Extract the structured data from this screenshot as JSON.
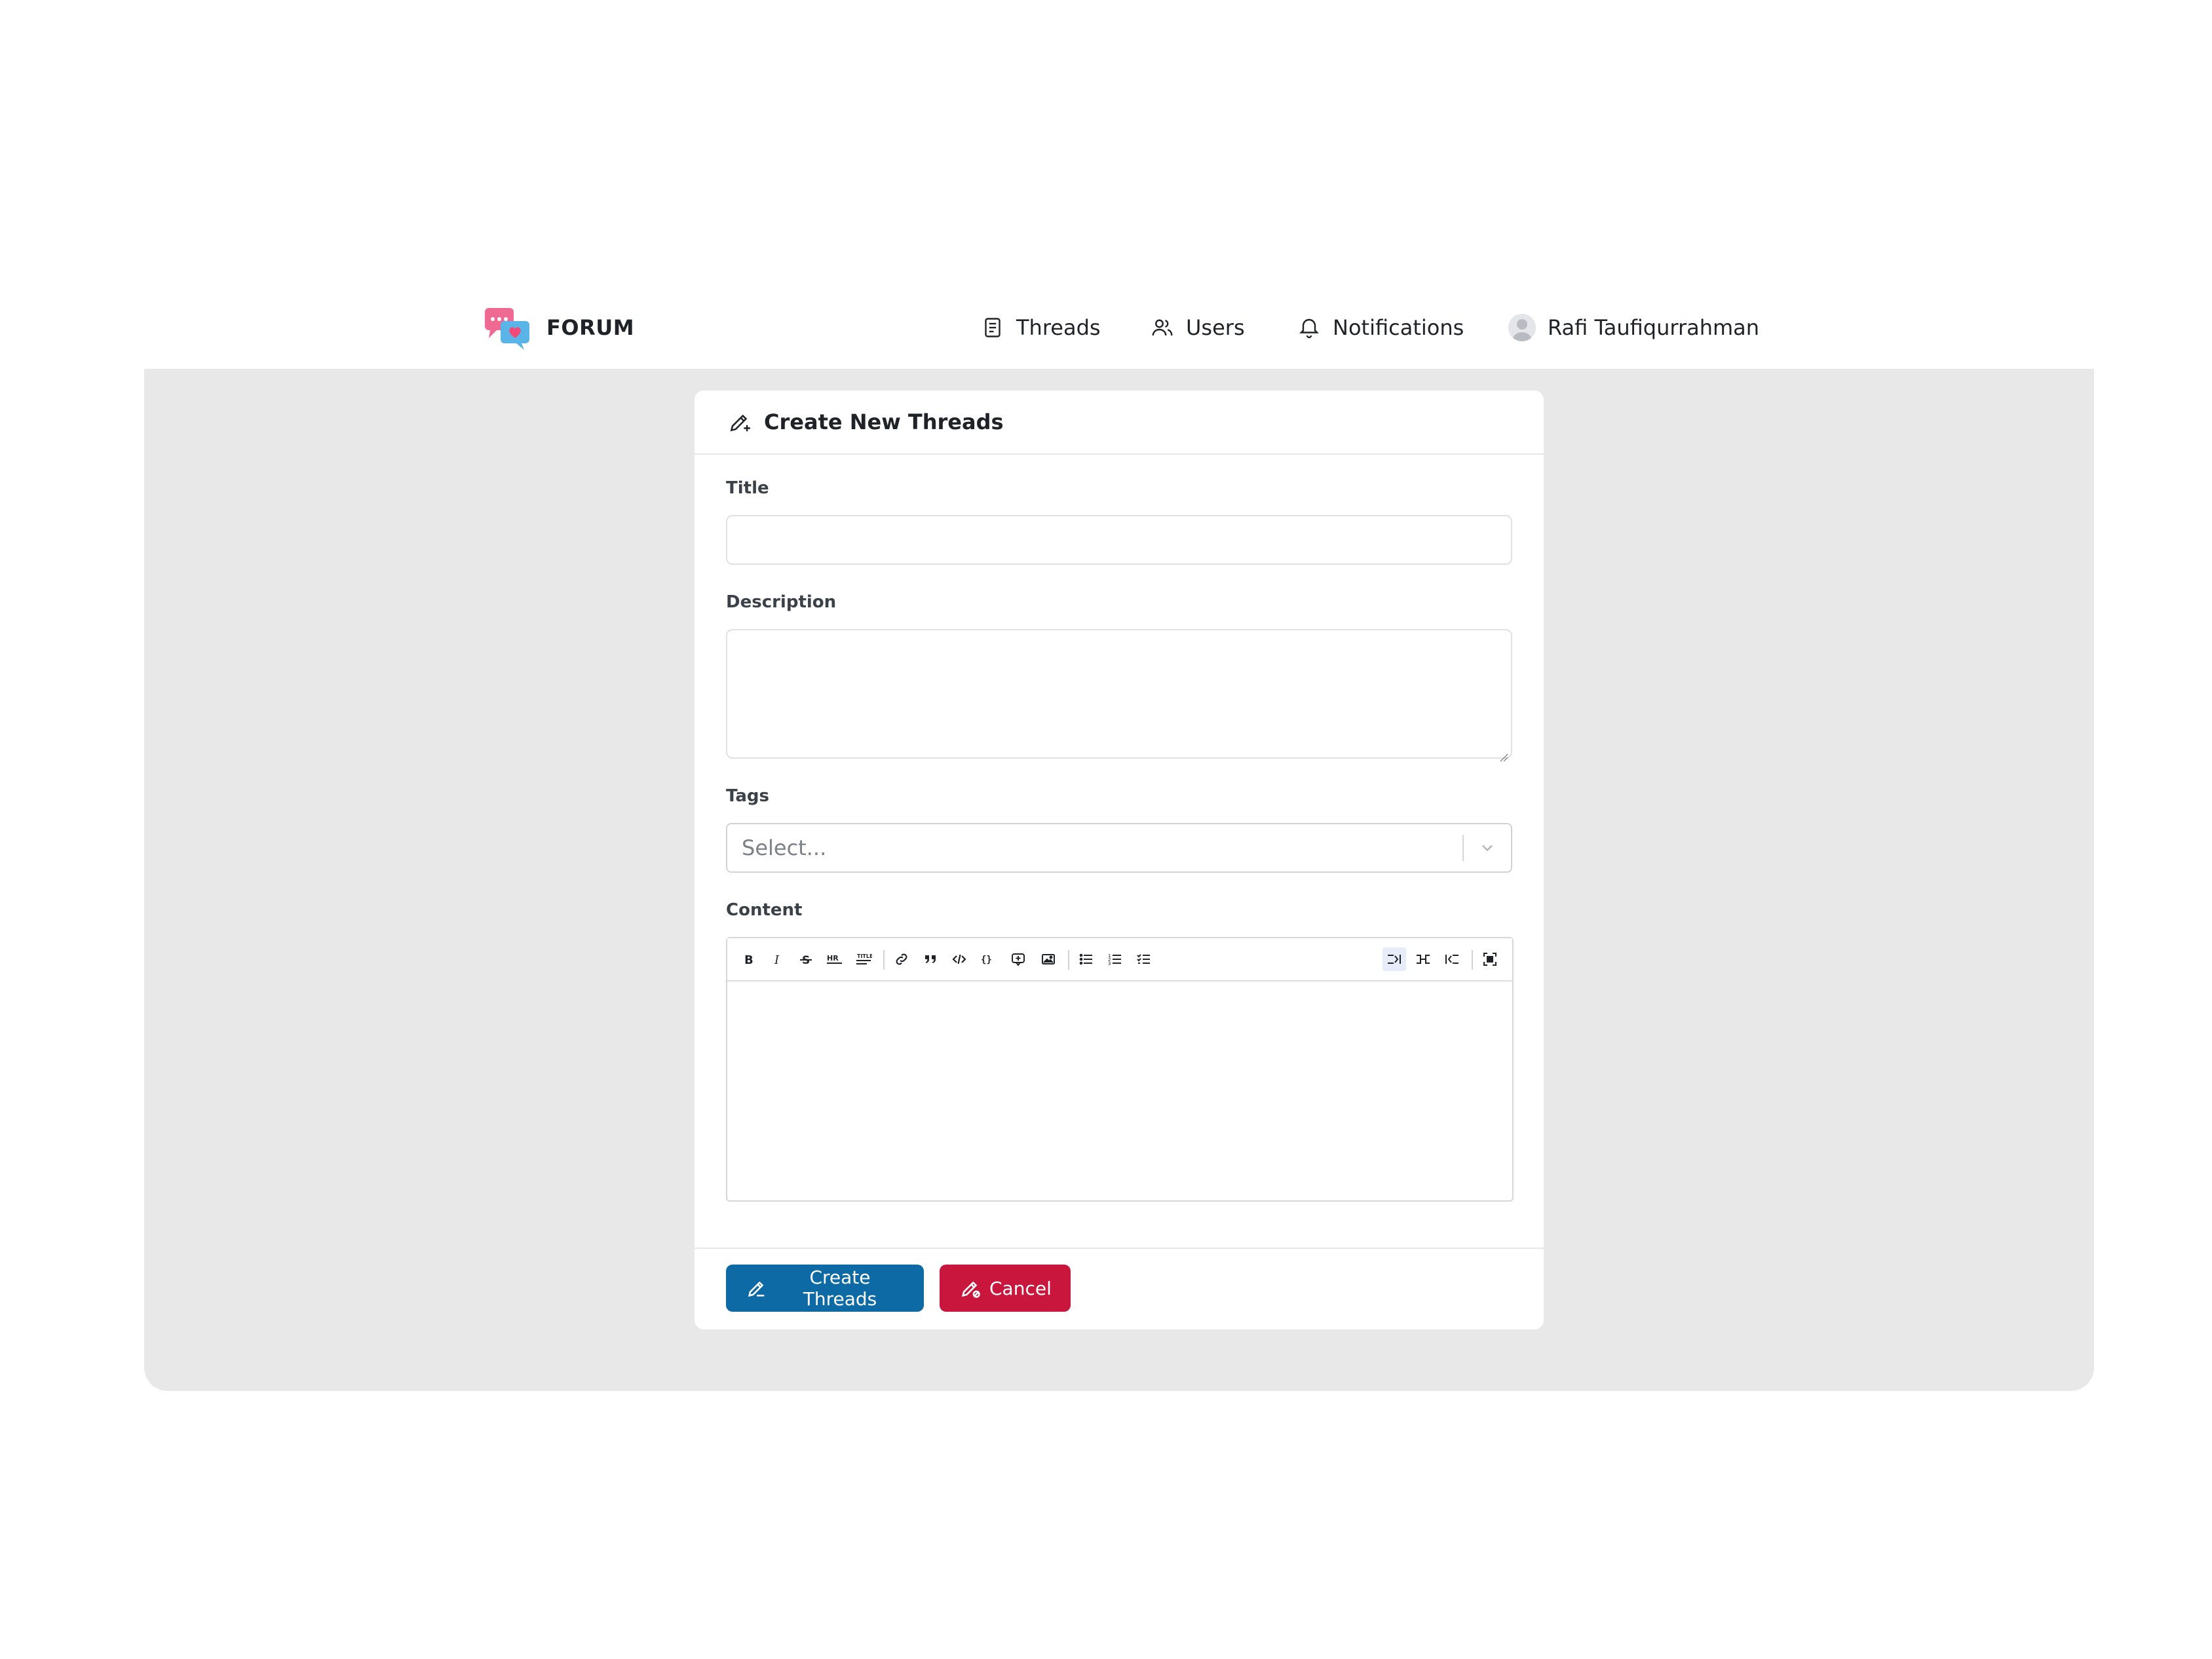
{
  "brand": {
    "name": "FORUM"
  },
  "nav": {
    "threads": "Threads",
    "users": "Users",
    "notifications": "Notifications",
    "profile": "Rafi Taufiqurrahman"
  },
  "card": {
    "title": "Create New Threads"
  },
  "form": {
    "title_label": "Title",
    "title_value": "",
    "description_label": "Description",
    "description_value": "",
    "tags_label": "Tags",
    "tags_placeholder": "Select...",
    "content_label": "Content"
  },
  "toolbar": {
    "tools": [
      "bold-icon",
      "italic-icon",
      "strikethrough-icon",
      "hr-icon",
      "title-icon",
      "link-icon",
      "quote-icon",
      "code-icon",
      "code-block-icon",
      "comment-icon",
      "image-icon",
      "unordered-list-icon",
      "ordered-list-icon",
      "checked-list-icon",
      "edit-mode-icon",
      "live-mode-icon",
      "preview-mode-icon",
      "fullscreen-icon"
    ],
    "active_mode": "edit-mode-icon"
  },
  "buttons": {
    "create": "Create Threads",
    "cancel": "Cancel"
  },
  "colors": {
    "primary": "#0e6aa4",
    "danger": "#c8163d",
    "background": "#e8e8e8",
    "logo_pink": "#ef6a93",
    "logo_blue": "#5ab4e8"
  }
}
